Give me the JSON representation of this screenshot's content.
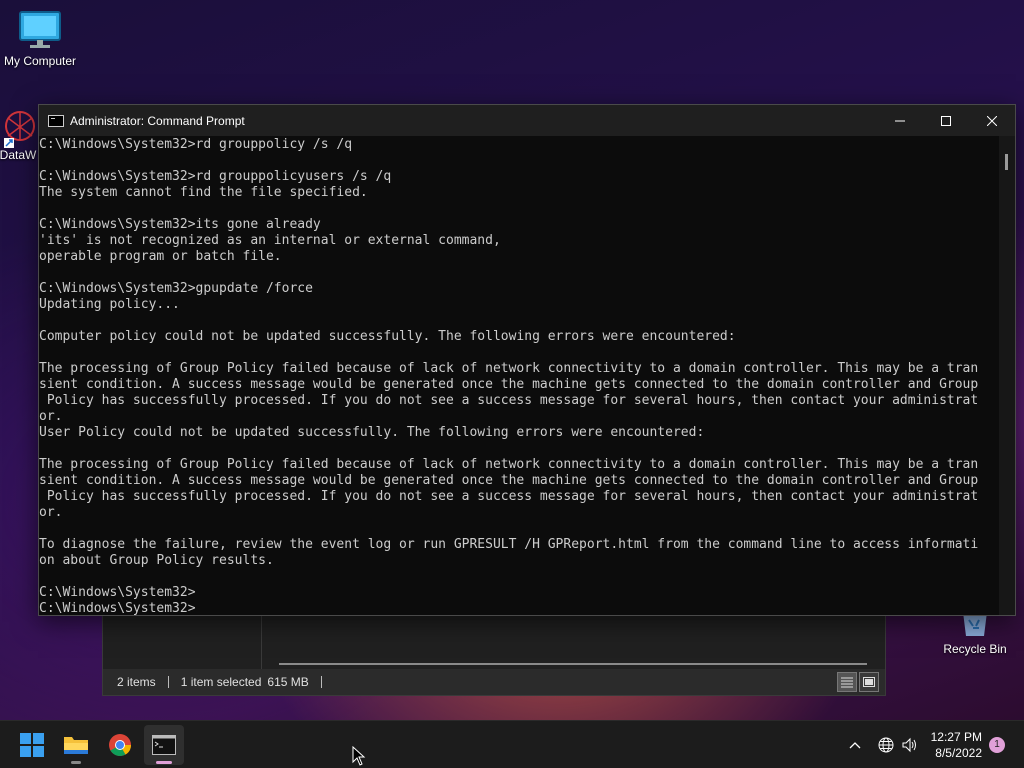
{
  "desktop": {
    "icons": [
      {
        "label": "My Computer",
        "icon": "monitor-icon"
      },
      {
        "label": "DataW",
        "icon": "datawarehouse-shortcut-icon"
      },
      {
        "label": "Recycle Bin",
        "icon": "recycle-bin-icon"
      }
    ]
  },
  "explorer": {
    "status": {
      "items_count": "2 items",
      "selection": "1 item selected",
      "size": "615 MB"
    }
  },
  "cmd": {
    "title": "Administrator: Command Prompt",
    "controls": {
      "minimize": "—",
      "maximize": "☐",
      "close": "✕"
    },
    "lines": [
      "C:\\Windows\\System32>rd grouppolicy /s /q",
      "",
      "C:\\Windows\\System32>rd grouppolicyusers /s /q",
      "The system cannot find the file specified.",
      "",
      "C:\\Windows\\System32>its gone already",
      "'its' is not recognized as an internal or external command,",
      "operable program or batch file.",
      "",
      "C:\\Windows\\System32>gpupdate /force",
      "Updating policy...",
      "",
      "Computer policy could not be updated successfully. The following errors were encountered:",
      "",
      "The processing of Group Policy failed because of lack of network connectivity to a domain controller. This may be a tran",
      "sient condition. A success message would be generated once the machine gets connected to the domain controller and Group",
      " Policy has successfully processed. If you do not see a success message for several hours, then contact your administrat",
      "or.",
      "User Policy could not be updated successfully. The following errors were encountered:",
      "",
      "The processing of Group Policy failed because of lack of network connectivity to a domain controller. This may be a tran",
      "sient condition. A success message would be generated once the machine gets connected to the domain controller and Group",
      " Policy has successfully processed. If you do not see a success message for several hours, then contact your administrat",
      "or.",
      "",
      "To diagnose the failure, review the event log or run GPRESULT /H GPReport.html from the command line to access informati",
      "on about Group Policy results.",
      "",
      "C:\\Windows\\System32>",
      "C:\\Windows\\System32>"
    ]
  },
  "taskbar": {
    "apps": [
      {
        "name": "start",
        "icon": "windows-start-icon"
      },
      {
        "name": "file-explorer",
        "icon": "folder-icon"
      },
      {
        "name": "chrome",
        "icon": "chrome-icon"
      },
      {
        "name": "command-prompt",
        "icon": "terminal-icon",
        "active": true
      }
    ],
    "tray": {
      "icons": [
        "chevron-up-icon",
        "globe-icon",
        "volume-icon"
      ]
    },
    "clock": {
      "time": "12:27 PM",
      "date": "8/5/2022"
    },
    "notifications": "1"
  }
}
